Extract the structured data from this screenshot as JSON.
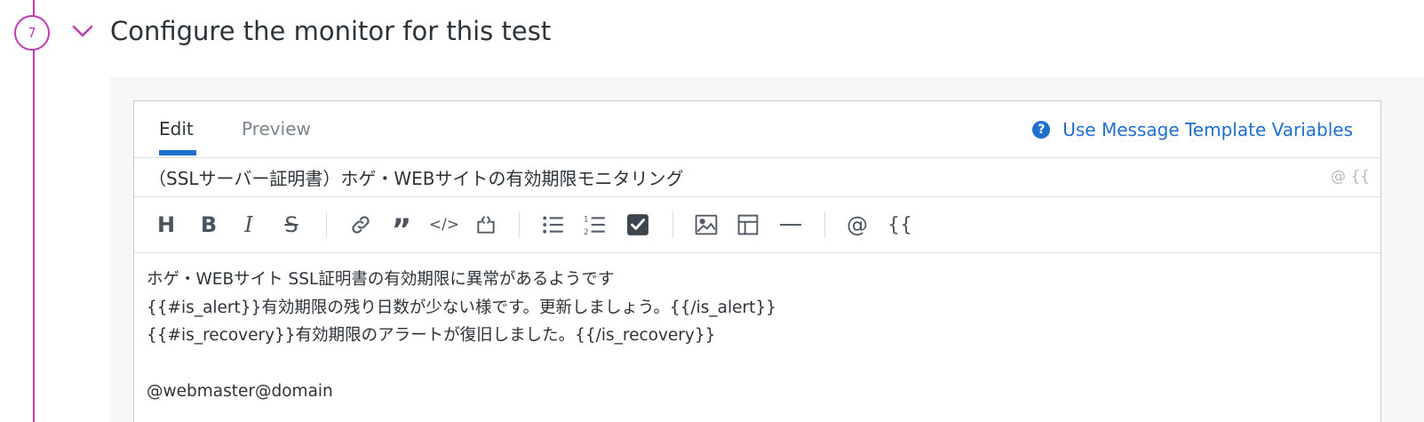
{
  "step": {
    "number": "7",
    "title": "Configure the monitor for this test"
  },
  "editor": {
    "tabs": [
      {
        "label": "Edit",
        "active": true
      },
      {
        "label": "Preview",
        "active": false
      }
    ],
    "help_link": "Use Message Template Variables",
    "subject": {
      "value": "（SSLサーバー証明書）ホゲ・WEBサイトの有効期限モニタリング",
      "tools": "@ {{"
    },
    "toolbar": {
      "heading": "H",
      "bold": "B",
      "italic": "I",
      "strikethrough": "S",
      "quote": "”",
      "code": "</>",
      "mention": "@",
      "variable": "{{",
      "icons": [
        "heading-icon",
        "bold-icon",
        "italic-icon",
        "strikethrough-icon",
        "link-icon",
        "quote-icon",
        "code-icon",
        "code-block-icon",
        "bulleted-list-icon",
        "numbered-list-icon",
        "checkbox-icon",
        "image-icon",
        "table-icon",
        "horizontal-rule-icon",
        "mention-icon",
        "template-variable-icon"
      ]
    },
    "body": {
      "lines": [
        "ホゲ・WEBサイト SSL証明書の有効期限に異常があるようです",
        "{{#is_alert}}有効期限の残り日数が少ない様です。更新しましょう。{{/is_alert}}",
        "{{#is_recovery}}有効期限のアラートが復旧しました。{{/is_recovery}}",
        "",
        "@webmaster@domain"
      ]
    }
  },
  "colors": {
    "step_accent": "#c13ab5",
    "link_blue": "#1f6fcf",
    "checkbox_fill": "#3d454e"
  }
}
